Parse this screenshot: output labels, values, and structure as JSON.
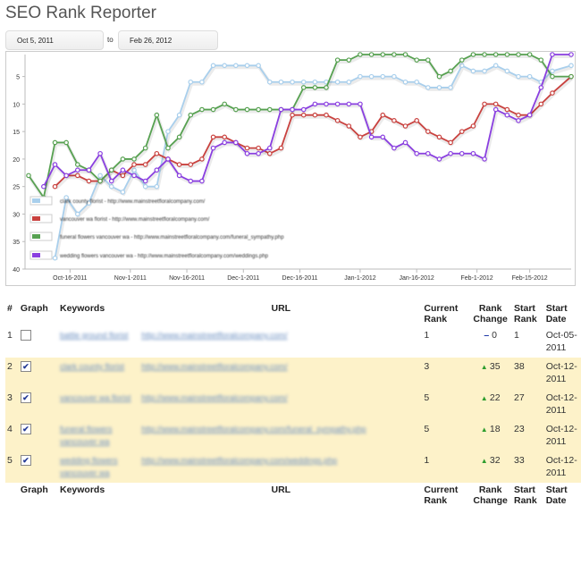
{
  "title": "SEO Rank Reporter",
  "date_from": "Oct 5, 2011",
  "date_to_label": "to",
  "date_to": "Feb 26, 2012",
  "chart_data": {
    "type": "line",
    "x": [
      "2011-10-05",
      "2011-10-09",
      "2011-10-12",
      "2011-10-15",
      "2011-10-18",
      "2011-10-21",
      "2011-10-24",
      "2011-10-27",
      "2011-10-30",
      "2011-11-02",
      "2011-11-05",
      "2011-11-08",
      "2011-11-11",
      "2011-11-14",
      "2011-11-17",
      "2011-11-20",
      "2011-11-23",
      "2011-11-26",
      "2011-11-29",
      "2011-12-02",
      "2011-12-05",
      "2011-12-08",
      "2011-12-11",
      "2011-12-14",
      "2011-12-17",
      "2011-12-20",
      "2011-12-23",
      "2011-12-26",
      "2011-12-29",
      "2012-01-01",
      "2012-01-04",
      "2012-01-07",
      "2012-01-10",
      "2012-01-13",
      "2012-01-16",
      "2012-01-19",
      "2012-01-22",
      "2012-01-25",
      "2012-01-28",
      "2012-01-31",
      "2012-02-03",
      "2012-02-06",
      "2012-02-09",
      "2012-02-12",
      "2012-02-15",
      "2012-02-18",
      "2012-02-21",
      "2012-02-26"
    ],
    "series": [
      {
        "name": "clark county florist",
        "color": "#a9cfec",
        "values": [
          null,
          null,
          38,
          27,
          30,
          28,
          23,
          25,
          26,
          22,
          25,
          25,
          15,
          12,
          6,
          6,
          3,
          3,
          3,
          3,
          3,
          6,
          6,
          6,
          6,
          6,
          6,
          6,
          6,
          5,
          5,
          5,
          5,
          6,
          6,
          7,
          7,
          7,
          3,
          4,
          4,
          3,
          4,
          5,
          5,
          6,
          4,
          3
        ]
      },
      {
        "name": "vancouver wa florist",
        "color": "#c9423f",
        "values": [
          null,
          null,
          25,
          23,
          23,
          24,
          24,
          22,
          23,
          21,
          21,
          19,
          20,
          21,
          21,
          20,
          16,
          16,
          17,
          18,
          18,
          19,
          18,
          12,
          12,
          12,
          12,
          13,
          14,
          16,
          15,
          12,
          13,
          14,
          13,
          15,
          16,
          17,
          15,
          14,
          10,
          10,
          11,
          12,
          12,
          10,
          8,
          5
        ]
      },
      {
        "name": "funeral flowers vancouver wa",
        "color": "#57a151",
        "values": [
          23,
          27,
          17,
          17,
          21,
          22,
          24,
          22,
          20,
          20,
          18,
          12,
          18,
          16,
          12,
          11,
          11,
          10,
          11,
          11,
          11,
          11,
          11,
          11,
          7,
          7,
          7,
          2,
          2,
          1,
          1,
          1,
          1,
          1,
          2,
          2,
          5,
          4,
          2,
          1,
          1,
          1,
          1,
          1,
          1,
          2,
          5,
          5
        ]
      },
      {
        "name": "wedding flowers vancouver wa",
        "color": "#8a3fe0",
        "values": [
          null,
          25,
          21,
          23,
          22,
          22,
          19,
          24,
          22,
          23,
          24,
          22,
          20,
          23,
          24,
          24,
          18,
          17,
          17,
          19,
          19,
          18,
          11,
          11,
          11,
          10,
          10,
          10,
          10,
          10,
          16,
          16,
          18,
          17,
          19,
          19,
          20,
          19,
          19,
          19,
          20,
          11,
          12,
          13,
          12,
          7,
          1,
          1
        ]
      }
    ],
    "x_ticks": [
      "Oct-16-2011",
      "Nov-1-2011",
      "Nov-16-2011",
      "Dec-1-2011",
      "Dec-16-2011",
      "Jan-1-2012",
      "Jan-16-2012",
      "Feb-1-2012",
      "Feb-15-2012"
    ],
    "y_ticks": [
      "5",
      "10",
      "15",
      "20",
      "25",
      "30",
      "35",
      "40"
    ],
    "ylim": [
      1,
      40
    ],
    "y_reversed": true,
    "legend_position": "bottom-left",
    "legend_entries": [
      "clark county florist - http://www.mainstreetfloralcompany.com/",
      "vancouver wa florist - http://www.mainstreetfloralcompany.com/",
      "funeral flowers vancouver wa - http://www.mainstreetfloralcompany.com/funeral_sympathy.php",
      "wedding flowers vancouver wa - http://www.mainstreetfloralcompany.com/weddings.php"
    ]
  },
  "table": {
    "headers": [
      "#",
      "Graph",
      "Keywords",
      "URL",
      "Current Rank",
      "Rank Change",
      "Start Rank",
      "Start Date"
    ],
    "rows": [
      {
        "num": "1",
        "checked": false,
        "keyword": "battle ground florist",
        "url": "http://www.mainstreetfloralcompany.com/",
        "current": "1",
        "change": "0",
        "dir": "none",
        "start": "1",
        "date": "Oct-05-2011"
      },
      {
        "num": "2",
        "checked": true,
        "keyword": "clark county florist",
        "url": "http://www.mainstreetfloralcompany.com/",
        "current": "3",
        "change": "35",
        "dir": "up",
        "start": "38",
        "date": "Oct-12-2011"
      },
      {
        "num": "3",
        "checked": true,
        "keyword": "vancouver wa florist",
        "url": "http://www.mainstreetfloralcompany.com/",
        "current": "5",
        "change": "22",
        "dir": "up",
        "start": "27",
        "date": "Oct-12-2011"
      },
      {
        "num": "4",
        "checked": true,
        "keyword": "funeral flowers vancouver wa",
        "url": "http://www.mainstreetfloralcompany.com/funeral_sympathy.php",
        "current": "5",
        "change": "18",
        "dir": "up",
        "start": "23",
        "date": "Oct-12-2011"
      },
      {
        "num": "5",
        "checked": true,
        "keyword": "wedding flowers vancouver wa",
        "url": "http://www.mainstreetfloralcompany.com/weddings.php",
        "current": "1",
        "change": "32",
        "dir": "up",
        "start": "33",
        "date": "Oct-12-2011"
      }
    ]
  }
}
